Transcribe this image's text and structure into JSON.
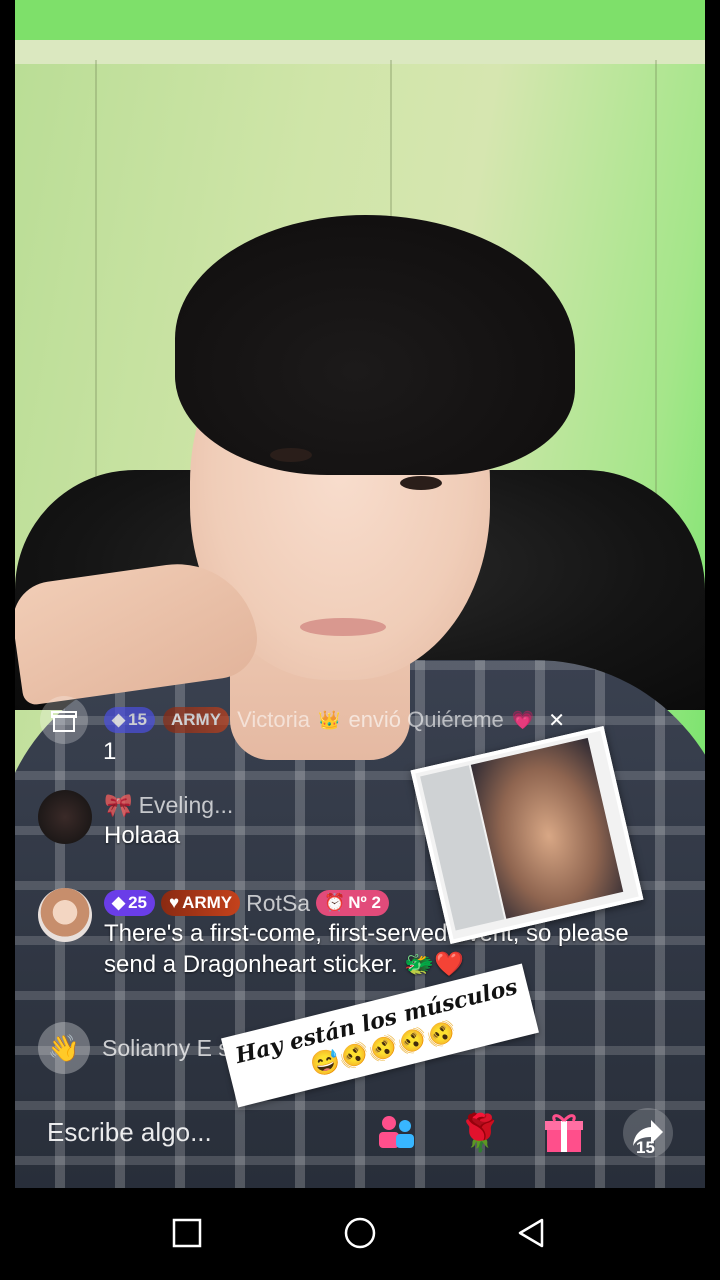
{
  "gift_notice": {
    "level": "15",
    "fan_badge": "ARMY",
    "user": "Victoria",
    "action": "envió Quiéreme",
    "count": "1",
    "close_icon": "close-icon"
  },
  "chat": [
    {
      "user": "Eveling...",
      "message": "Holaaa"
    },
    {
      "level": "25",
      "fan_badge": "ARMY",
      "user": "RotSa",
      "rank": "Nº 2",
      "message": "There's a first-come, first-served event, so please send a Dragonheart sticker. 🐲❤️"
    }
  ],
  "join": {
    "text": "Solianny E se uni..."
  },
  "sticker_caption": {
    "line1": "Hay están los músculos",
    "line2": "😅🫨🫨🫨🫨"
  },
  "bottom_bar": {
    "comment_placeholder": "Escribe algo...",
    "share_count": "15",
    "icons": [
      "invite-icon",
      "rose-icon",
      "gift-icon",
      "share-icon"
    ]
  },
  "colors": {
    "level_blue": "#4b4fe0",
    "army_orange": "#c4421c",
    "rank_pink": "#e24b7a",
    "gift_pink": "#ff4f8b"
  }
}
